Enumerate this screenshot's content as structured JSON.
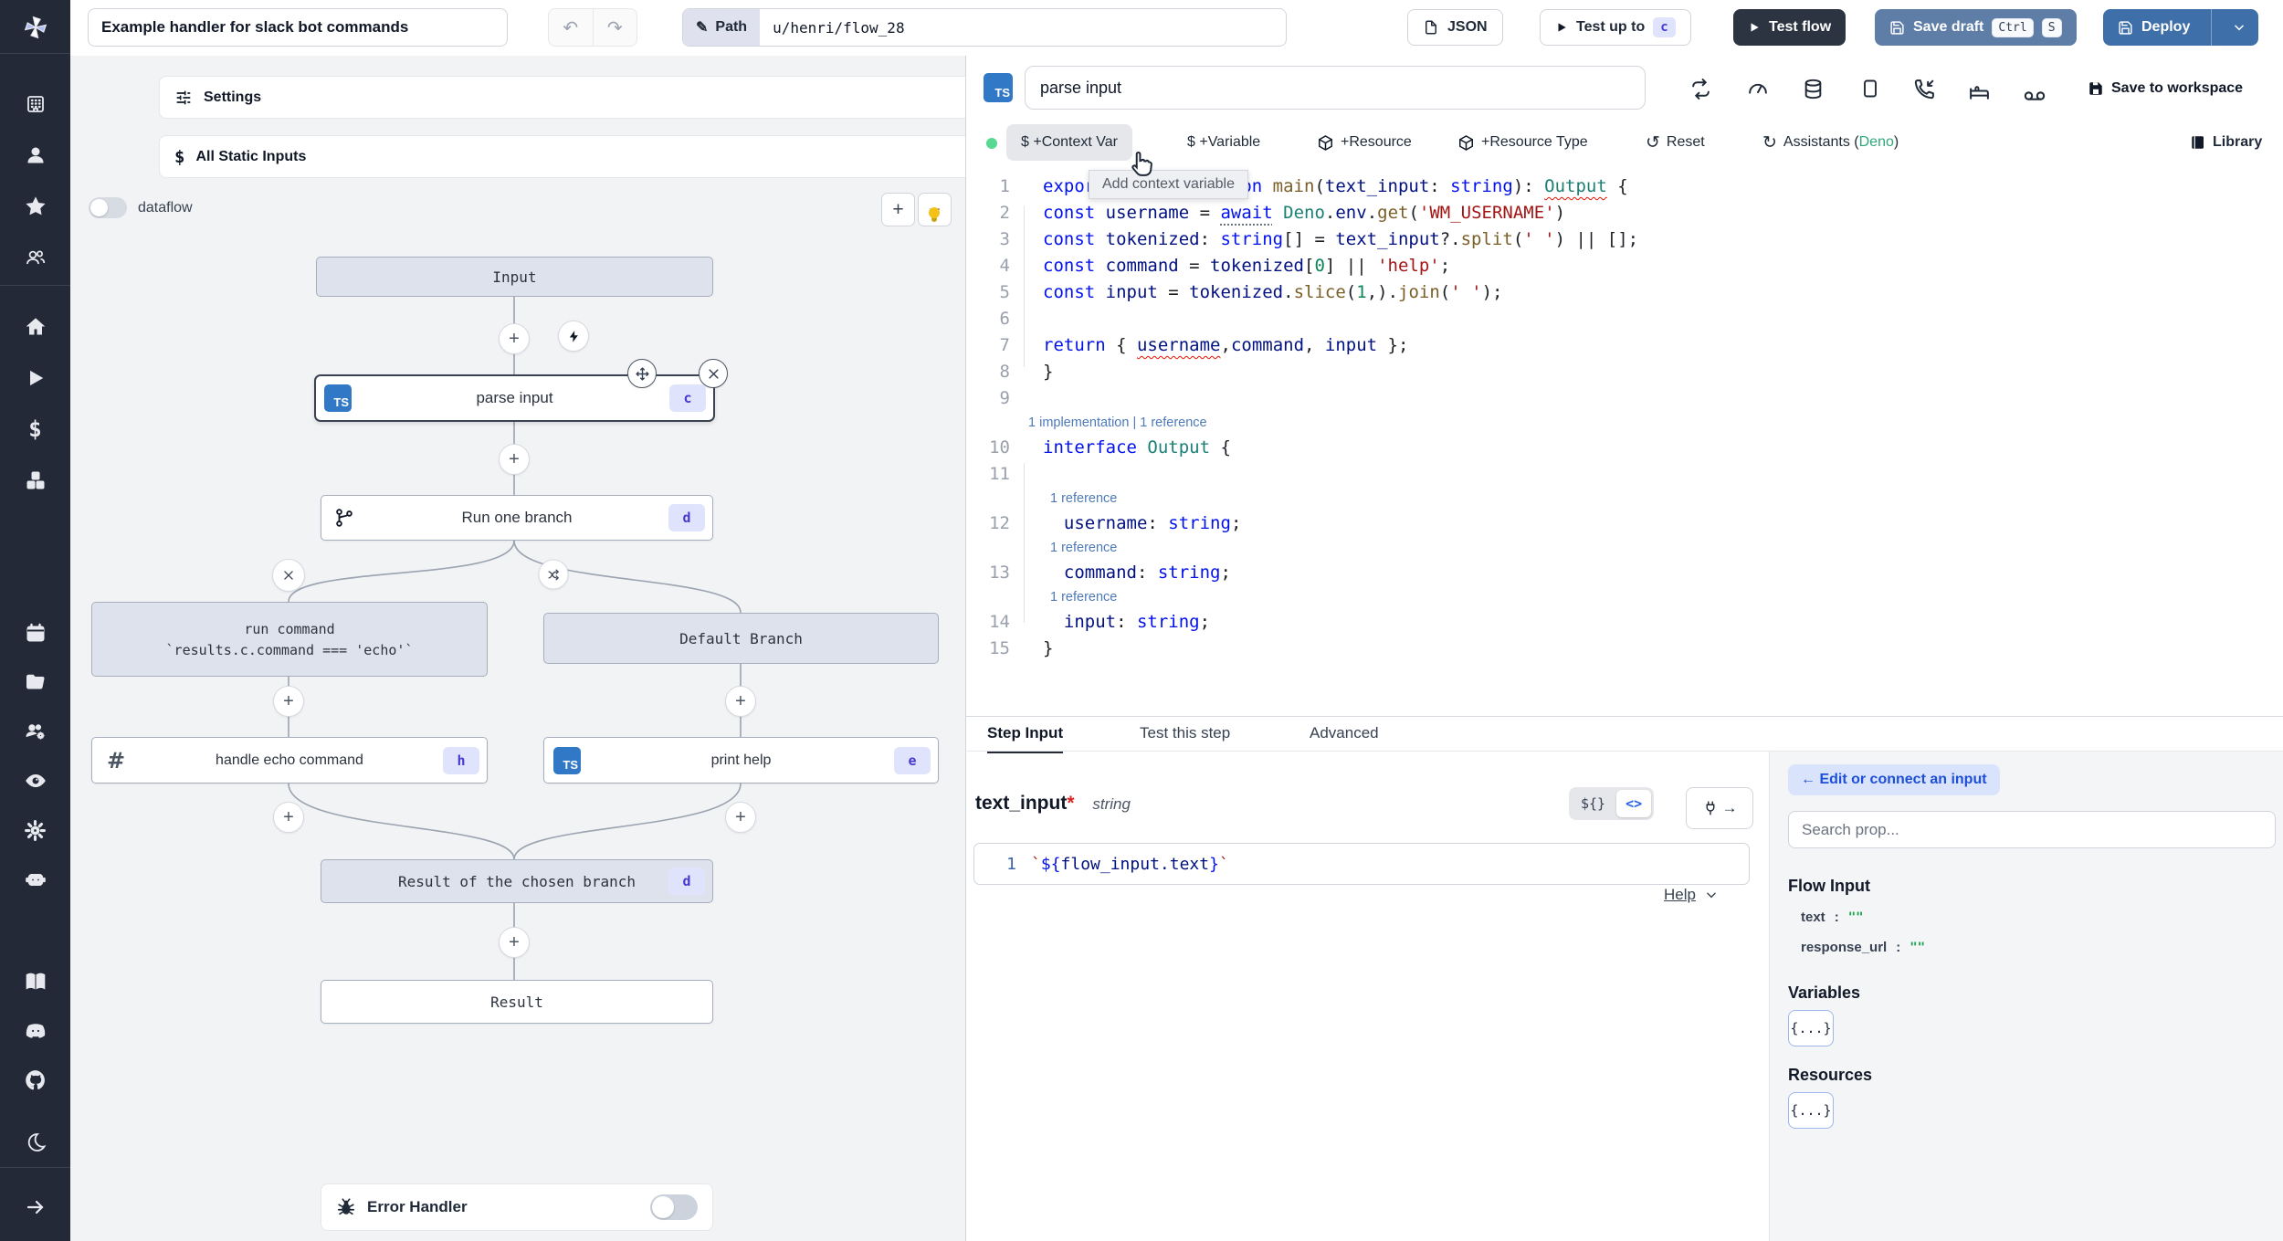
{
  "topbar": {
    "title": "Example handler for slack bot commands",
    "path_label": "Path",
    "path_value": "u/henri/flow_28",
    "json_label": "JSON",
    "test_up_to": "Test up to",
    "test_up_to_badge": "c",
    "test_flow": "Test flow",
    "save_draft": "Save draft",
    "kbd_ctrl": "Ctrl",
    "kbd_s": "S",
    "deploy": "Deploy"
  },
  "flow_panel": {
    "settings": "Settings",
    "all_static_inputs": "All Static Inputs",
    "dataflow_label": "dataflow",
    "zoom_in": "+",
    "zoom_out": "−"
  },
  "flow": {
    "input": "Input",
    "parse": {
      "label": "parse input",
      "badge": "c"
    },
    "run_one_branch": {
      "label": "Run one branch",
      "badge": "d"
    },
    "run_command": {
      "line1": "run command",
      "line2": "`results.c.command === 'echo'`"
    },
    "default_branch": "Default Branch",
    "handle_echo": {
      "label": "handle echo command",
      "badge": "h"
    },
    "print_help": {
      "label": "print help",
      "badge": "e"
    },
    "chosen": {
      "label": "Result of the chosen branch",
      "badge": "d"
    },
    "result": "Result",
    "error_handler": "Error Handler"
  },
  "editor": {
    "step_name": "parse input",
    "toolbar": {
      "context_var": "$ +Context Var",
      "variable": "$ +Variable",
      "resource": "+Resource",
      "resource_type": "+Resource Type",
      "reset": "Reset",
      "assistants_prefix": "Assistants (",
      "assistants_lang": "Deno",
      "assistants_suffix": ")",
      "library": "Library",
      "save_to_workspace": "Save to workspace",
      "tooltip": "Add context variable"
    },
    "code": {
      "rows": [
        {
          "n": "1",
          "s": [
            [
              "k",
              "export async function "
            ],
            [
              "f",
              "main"
            ],
            [
              "p",
              "("
            ],
            [
              "v",
              "text_input"
            ],
            [
              "p",
              ": "
            ],
            [
              "k",
              "string"
            ],
            [
              "p",
              "): "
            ],
            [
              "tq",
              "Output"
            ],
            [
              "p",
              " {"
            ]
          ]
        },
        {
          "n": "2",
          "bulb": true,
          "s": [
            [
              "k",
              "const "
            ],
            [
              "v",
              "username"
            ],
            [
              "p",
              " = "
            ],
            [
              "kd",
              "await"
            ],
            [
              "p",
              " "
            ],
            [
              "t",
              "Deno"
            ],
            [
              "p",
              "."
            ],
            [
              "v",
              "env"
            ],
            [
              "p",
              "."
            ],
            [
              "f",
              "get"
            ],
            [
              "p",
              "("
            ],
            [
              "s",
              "'WM_USERNAME'"
            ],
            [
              "p",
              ")"
            ]
          ]
        },
        {
          "n": "3",
          "s": [
            [
              "k",
              "const "
            ],
            [
              "v",
              "tokenized"
            ],
            [
              "p",
              ": "
            ],
            [
              "k",
              "string"
            ],
            [
              "p",
              "[] = "
            ],
            [
              "v",
              "text_input"
            ],
            [
              "p",
              "?."
            ],
            [
              "f",
              "split"
            ],
            [
              "p",
              "("
            ],
            [
              "s",
              "' '"
            ],
            [
              "p",
              ") || [];"
            ]
          ]
        },
        {
          "n": "4",
          "s": [
            [
              "k",
              "const "
            ],
            [
              "v",
              "command"
            ],
            [
              "p",
              " = "
            ],
            [
              "v",
              "tokenized"
            ],
            [
              "p",
              "["
            ],
            [
              "n",
              "0"
            ],
            [
              "p",
              "] || "
            ],
            [
              "s",
              "'help'"
            ],
            [
              "p",
              ";"
            ]
          ]
        },
        {
          "n": "5",
          "s": [
            [
              "k",
              "const "
            ],
            [
              "v",
              "input"
            ],
            [
              "p",
              " = "
            ],
            [
              "v",
              "tokenized"
            ],
            [
              "p",
              "."
            ],
            [
              "f",
              "slice"
            ],
            [
              "p",
              "("
            ],
            [
              "n",
              "1"
            ],
            [
              "p",
              ",)."
            ],
            [
              "f",
              "join"
            ],
            [
              "p",
              "("
            ],
            [
              "s",
              "' '"
            ],
            [
              "p",
              ");"
            ]
          ]
        },
        {
          "n": "6",
          "s": []
        },
        {
          "n": "7",
          "s": [
            [
              "k",
              "return"
            ],
            [
              "p",
              " { "
            ],
            [
              "vq",
              "username"
            ],
            [
              "p",
              ","
            ],
            [
              "v",
              "command"
            ],
            [
              "p",
              ", "
            ],
            [
              "v",
              "input"
            ],
            [
              "p",
              " };"
            ]
          ]
        },
        {
          "n": "8",
          "s": [
            [
              "p",
              "}"
            ]
          ]
        },
        {
          "n": "9",
          "s": []
        },
        {
          "lens": "1 implementation | 1 reference",
          "indent": 0
        },
        {
          "n": "10",
          "s": [
            [
              "k",
              "interface "
            ],
            [
              "t",
              "Output"
            ],
            [
              "p",
              " {"
            ]
          ]
        },
        {
          "n": "11",
          "s": []
        },
        {
          "lens": "1 reference",
          "indent": 1
        },
        {
          "n": "12",
          "s": [
            [
              "p",
              "  "
            ],
            [
              "v",
              "username"
            ],
            [
              "p",
              ": "
            ],
            [
              "k",
              "string"
            ],
            [
              "p",
              ";"
            ]
          ]
        },
        {
          "lens": "1 reference",
          "indent": 1
        },
        {
          "n": "13",
          "s": [
            [
              "p",
              "  "
            ],
            [
              "v",
              "command"
            ],
            [
              "p",
              ": "
            ],
            [
              "k",
              "string"
            ],
            [
              "p",
              ";"
            ]
          ]
        },
        {
          "lens": "1 reference",
          "indent": 1
        },
        {
          "n": "14",
          "s": [
            [
              "p",
              "  "
            ],
            [
              "v",
              "input"
            ],
            [
              "p",
              ": "
            ],
            [
              "k",
              "string"
            ],
            [
              "p",
              ";"
            ]
          ]
        },
        {
          "n": "15",
          "s": [
            [
              "p",
              "}"
            ]
          ]
        }
      ]
    }
  },
  "step_panel": {
    "tabs": [
      "Step Input",
      "Test this step",
      "Advanced"
    ],
    "field_name": "text_input",
    "required_mark": "*",
    "field_type": "string",
    "toggle_template": "${}",
    "toggle_code": "<>",
    "line_no": "1",
    "mini": [
      [
        "s",
        "`"
      ],
      [
        "k",
        "${"
      ],
      [
        "v",
        "flow_input.text"
      ],
      [
        "k",
        "}"
      ],
      [
        "s",
        "`"
      ]
    ],
    "help": "Help"
  },
  "connect_panel": {
    "back": "← Edit or connect an input",
    "search_placeholder": "Search prop...",
    "flow_input_title": "Flow Input",
    "props": [
      {
        "name": "text",
        "sep": ":",
        "value": "\"\""
      },
      {
        "name": "response_url",
        "sep": ":",
        "value": "\"\""
      }
    ],
    "variables_title": "Variables",
    "variables_chip": "{...}",
    "resources_title": "Resources",
    "resources_chip": "{...}"
  }
}
